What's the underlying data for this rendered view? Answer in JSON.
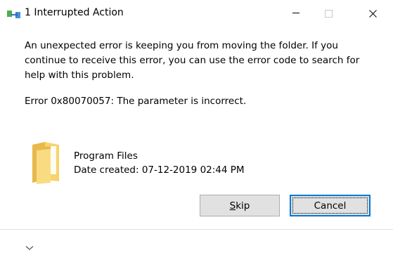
{
  "window": {
    "title": "1 Interrupted Action",
    "title_icon": "move-folder-arrow-icon",
    "controls": {
      "minimize_icon": "minimize-icon",
      "maximize_icon": "maximize-icon",
      "close_icon": "close-icon"
    }
  },
  "dialog": {
    "message": "An unexpected error is keeping you from moving the folder. If you continue to receive this error, you can use the error code to search for help with this problem.",
    "error": "Error 0x80070057: The parameter is incorrect.",
    "item": {
      "icon": "folder-icon",
      "name": "Program Files",
      "date_created": "Date created: 07-12-2019 02:44 PM"
    },
    "buttons": {
      "skip": "Skip",
      "cancel": "Cancel"
    }
  },
  "footer": {
    "expand_icon": "chevron-down-icon"
  },
  "colors": {
    "background": "#ffffff",
    "button_face": "#e1e1e1",
    "button_border": "#adadad",
    "focus_border": "#0078d7",
    "folder_yellow": "#f6d36b"
  }
}
